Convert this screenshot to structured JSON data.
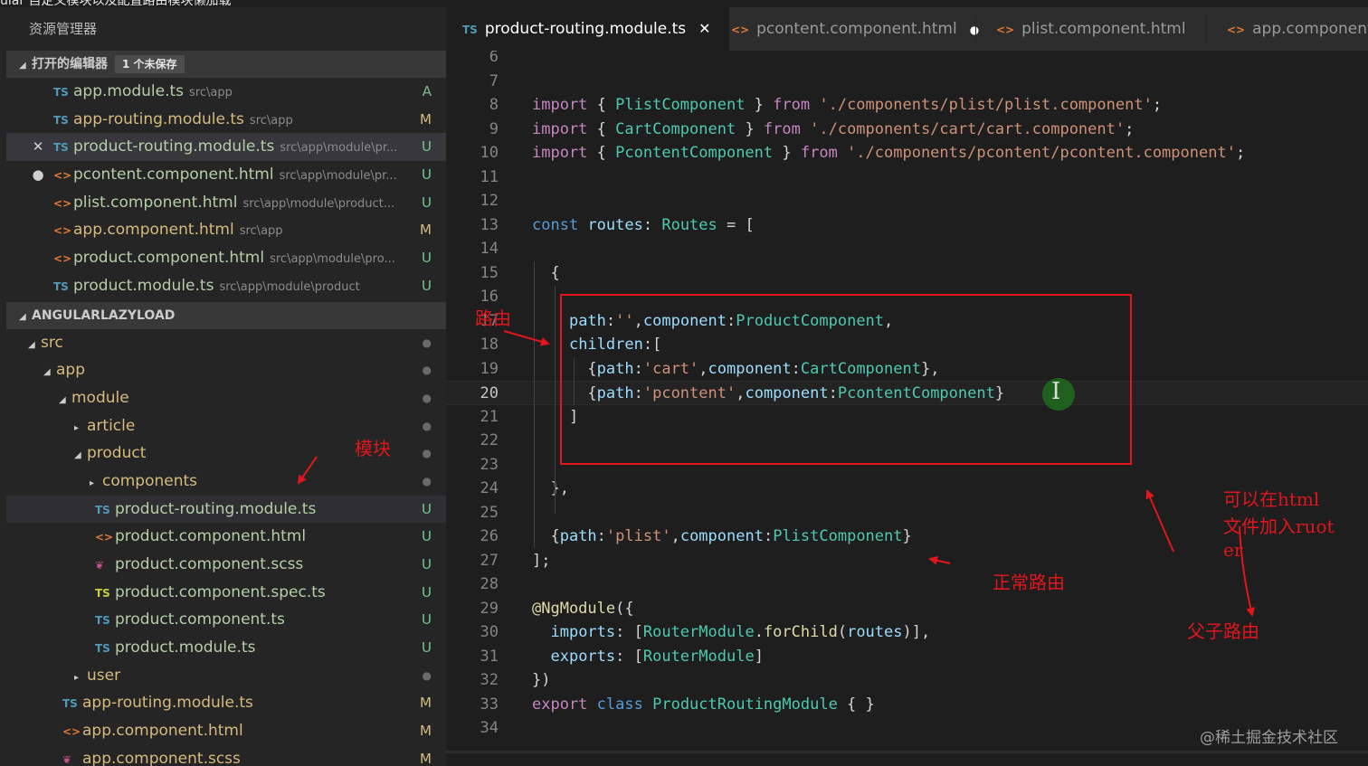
{
  "window": {
    "title_fragment": "ular 自定义模块以及配置路由模块懒加载"
  },
  "sidebar": {
    "title": "资源管理器",
    "open_editors": {
      "label": "打开的编辑器",
      "badge": "1 个未保存",
      "items": [
        {
          "icon": "TS",
          "name": "app.module.ts",
          "path": "src\\app",
          "status": "A",
          "marker": ""
        },
        {
          "icon": "TS",
          "name": "app-routing.module.ts",
          "path": "src\\app",
          "status": "M",
          "marker": ""
        },
        {
          "icon": "TS",
          "name": "product-routing.module.ts",
          "path": "src\\app\\module\\pr...",
          "status": "U",
          "marker": "✕"
        },
        {
          "icon": "<>",
          "name": "pcontent.component.html",
          "path": "src\\app\\module\\pr...",
          "status": "U",
          "marker": "●"
        },
        {
          "icon": "<>",
          "name": "plist.component.html",
          "path": "src\\app\\module\\product...",
          "status": "U",
          "marker": ""
        },
        {
          "icon": "<>",
          "name": "app.component.html",
          "path": "src\\app",
          "status": "M",
          "marker": ""
        },
        {
          "icon": "<>",
          "name": "product.component.html",
          "path": "src\\app\\module\\pro...",
          "status": "U",
          "marker": ""
        },
        {
          "icon": "TS",
          "name": "product.module.ts",
          "path": "src\\app\\module\\product",
          "status": "U",
          "marker": ""
        }
      ]
    },
    "project": {
      "label": "ANGULARLAZYLOAD",
      "tree": [
        {
          "name": "src",
          "depth": 0,
          "twisty": "◢",
          "status": "●",
          "icon": ""
        },
        {
          "name": "app",
          "depth": 1,
          "twisty": "◢",
          "status": "●",
          "icon": ""
        },
        {
          "name": "module",
          "depth": 2,
          "twisty": "◢",
          "status": "●",
          "icon": ""
        },
        {
          "name": "article",
          "depth": 3,
          "twisty": "▸",
          "status": "●",
          "icon": ""
        },
        {
          "name": "product",
          "depth": 3,
          "twisty": "◢",
          "status": "●",
          "icon": ""
        },
        {
          "name": "components",
          "depth": 4,
          "twisty": "▸",
          "status": "●",
          "icon": ""
        },
        {
          "name": "product-routing.module.ts",
          "depth": 4,
          "twisty": "",
          "status": "U",
          "icon": "TS"
        },
        {
          "name": "product.component.html",
          "depth": 4,
          "twisty": "",
          "status": "U",
          "icon": "<>"
        },
        {
          "name": "product.component.scss",
          "depth": 4,
          "twisty": "",
          "status": "U",
          "icon": "scss"
        },
        {
          "name": "product.component.spec.ts",
          "depth": 4,
          "twisty": "",
          "status": "U",
          "icon": "spec"
        },
        {
          "name": "product.component.ts",
          "depth": 4,
          "twisty": "",
          "status": "U",
          "icon": "TS"
        },
        {
          "name": "product.module.ts",
          "depth": 4,
          "twisty": "",
          "status": "U",
          "icon": "TS"
        },
        {
          "name": "user",
          "depth": 3,
          "twisty": "▸",
          "status": "●",
          "icon": ""
        },
        {
          "name": "app-routing.module.ts",
          "depth": 2,
          "twisty": "",
          "status": "M",
          "icon": "TS"
        },
        {
          "name": "app.component.html",
          "depth": 2,
          "twisty": "",
          "status": "M",
          "icon": "<>"
        },
        {
          "name": "app.component.scss",
          "depth": 2,
          "twisty": "",
          "status": "M",
          "icon": "scss"
        }
      ]
    }
  },
  "tabs": [
    {
      "icon": "TS",
      "label": "product-routing.module.ts",
      "active": true,
      "suffix": "✕"
    },
    {
      "icon": "<>",
      "label": "pcontent.component.html",
      "active": false,
      "suffix": "●"
    },
    {
      "icon": "<>",
      "label": "plist.component.html",
      "active": false,
      "suffix": ""
    },
    {
      "icon": "<>",
      "label": "app.component.html",
      "active": false,
      "suffix": ""
    }
  ],
  "editor": {
    "current_line": "20",
    "lines": [
      {
        "n": "6",
        "tokens": []
      },
      {
        "n": "7",
        "tokens": []
      },
      {
        "n": "8",
        "tokens": [
          [
            "kc",
            "import"
          ],
          [
            "p",
            " { "
          ],
          [
            "cls",
            "PlistComponent"
          ],
          [
            "p",
            " } "
          ],
          [
            "kc",
            "from"
          ],
          [
            "p",
            " "
          ],
          [
            "str",
            "'./components/plist/plist.component'"
          ],
          [
            "p",
            ";"
          ]
        ]
      },
      {
        "n": "9",
        "tokens": [
          [
            "kc",
            "import"
          ],
          [
            "p",
            " { "
          ],
          [
            "cls",
            "CartComponent"
          ],
          [
            "p",
            " } "
          ],
          [
            "kc",
            "from"
          ],
          [
            "p",
            " "
          ],
          [
            "str",
            "'./components/cart/cart.component'"
          ],
          [
            "p",
            ";"
          ]
        ]
      },
      {
        "n": "10",
        "tokens": [
          [
            "kc",
            "import"
          ],
          [
            "p",
            " { "
          ],
          [
            "cls",
            "PcontentComponent"
          ],
          [
            "p",
            " } "
          ],
          [
            "kc",
            "from"
          ],
          [
            "p",
            " "
          ],
          [
            "str",
            "'./components/pcontent/pcontent.component'"
          ],
          [
            "p",
            ";"
          ]
        ]
      },
      {
        "n": "11",
        "tokens": []
      },
      {
        "n": "12",
        "tokens": []
      },
      {
        "n": "13",
        "tokens": [
          [
            "kw",
            "const"
          ],
          [
            "p",
            " "
          ],
          [
            "prop",
            "routes"
          ],
          [
            "p",
            ": "
          ],
          [
            "cls",
            "Routes"
          ],
          [
            "p",
            " = ["
          ]
        ]
      },
      {
        "n": "14",
        "tokens": []
      },
      {
        "n": "15",
        "tokens": [
          [
            "p",
            "  {"
          ]
        ]
      },
      {
        "n": "16",
        "tokens": []
      },
      {
        "n": "17",
        "tokens": [
          [
            "p",
            "    "
          ],
          [
            "prop",
            "path"
          ],
          [
            "p",
            ":"
          ],
          [
            "str",
            "''"
          ],
          [
            "p",
            ","
          ],
          [
            "prop",
            "component"
          ],
          [
            "p",
            ":"
          ],
          [
            "cls",
            "ProductComponent"
          ],
          [
            "p",
            ","
          ]
        ]
      },
      {
        "n": "18",
        "tokens": [
          [
            "p",
            "    "
          ],
          [
            "prop",
            "children"
          ],
          [
            "p",
            ":["
          ]
        ]
      },
      {
        "n": "19",
        "tokens": [
          [
            "p",
            "      {"
          ],
          [
            "prop",
            "path"
          ],
          [
            "p",
            ":"
          ],
          [
            "str",
            "'cart'"
          ],
          [
            "p",
            ","
          ],
          [
            "prop",
            "component"
          ],
          [
            "p",
            ":"
          ],
          [
            "cls",
            "CartComponent"
          ],
          [
            "p",
            "},"
          ]
        ]
      },
      {
        "n": "20",
        "tokens": [
          [
            "p",
            "      {"
          ],
          [
            "prop",
            "path"
          ],
          [
            "p",
            ":"
          ],
          [
            "str",
            "'pcontent'"
          ],
          [
            "p",
            ","
          ],
          [
            "prop",
            "component"
          ],
          [
            "p",
            ":"
          ],
          [
            "cls",
            "PcontentComponent"
          ],
          [
            "p",
            "}"
          ]
        ]
      },
      {
        "n": "21",
        "tokens": [
          [
            "p",
            "    ]"
          ]
        ]
      },
      {
        "n": "22",
        "tokens": []
      },
      {
        "n": "23",
        "tokens": []
      },
      {
        "n": "24",
        "tokens": [
          [
            "p",
            "  },"
          ]
        ]
      },
      {
        "n": "25",
        "tokens": []
      },
      {
        "n": "26",
        "tokens": [
          [
            "p",
            "  {"
          ],
          [
            "prop",
            "path"
          ],
          [
            "p",
            ":"
          ],
          [
            "str",
            "'plist'"
          ],
          [
            "p",
            ","
          ],
          [
            "prop",
            "component"
          ],
          [
            "p",
            ":"
          ],
          [
            "cls",
            "PlistComponent"
          ],
          [
            "p",
            "}"
          ]
        ]
      },
      {
        "n": "27",
        "tokens": [
          [
            "p",
            "];"
          ]
        ]
      },
      {
        "n": "28",
        "tokens": []
      },
      {
        "n": "29",
        "tokens": [
          [
            "fn",
            "@NgModule"
          ],
          [
            "p",
            "({"
          ]
        ]
      },
      {
        "n": "30",
        "tokens": [
          [
            "p",
            "  "
          ],
          [
            "prop",
            "imports"
          ],
          [
            "p",
            ": ["
          ],
          [
            "cls",
            "RouterModule"
          ],
          [
            "p",
            "."
          ],
          [
            "fn",
            "forChild"
          ],
          [
            "p",
            "("
          ],
          [
            "prop",
            "routes"
          ],
          [
            "p",
            ")],"
          ]
        ]
      },
      {
        "n": "31",
        "tokens": [
          [
            "p",
            "  "
          ],
          [
            "prop",
            "exports"
          ],
          [
            "p",
            ": ["
          ],
          [
            "cls",
            "RouterModule"
          ],
          [
            "p",
            "]"
          ]
        ]
      },
      {
        "n": "32",
        "tokens": [
          [
            "p",
            "})"
          ]
        ]
      },
      {
        "n": "33",
        "tokens": [
          [
            "kc",
            "export"
          ],
          [
            "p",
            " "
          ],
          [
            "kw",
            "class"
          ],
          [
            "p",
            " "
          ],
          [
            "cls",
            "ProductRoutingModule"
          ],
          [
            "p",
            " { }"
          ]
        ]
      },
      {
        "n": "34",
        "tokens": []
      }
    ]
  },
  "annotations": {
    "route": "路由",
    "module": "模块",
    "normal_route": "正常路由",
    "parent_child_route": "父子路由",
    "router_note_line1": "可以在html",
    "router_note_line2": "文件加入ruot",
    "router_note_line3": "er"
  },
  "watermark": "@稀土掘金技术社区",
  "colors": {
    "annotation_red": "#e0161d",
    "editor_bg": "#1e1e1e",
    "sidebar_bg": "#252526"
  }
}
